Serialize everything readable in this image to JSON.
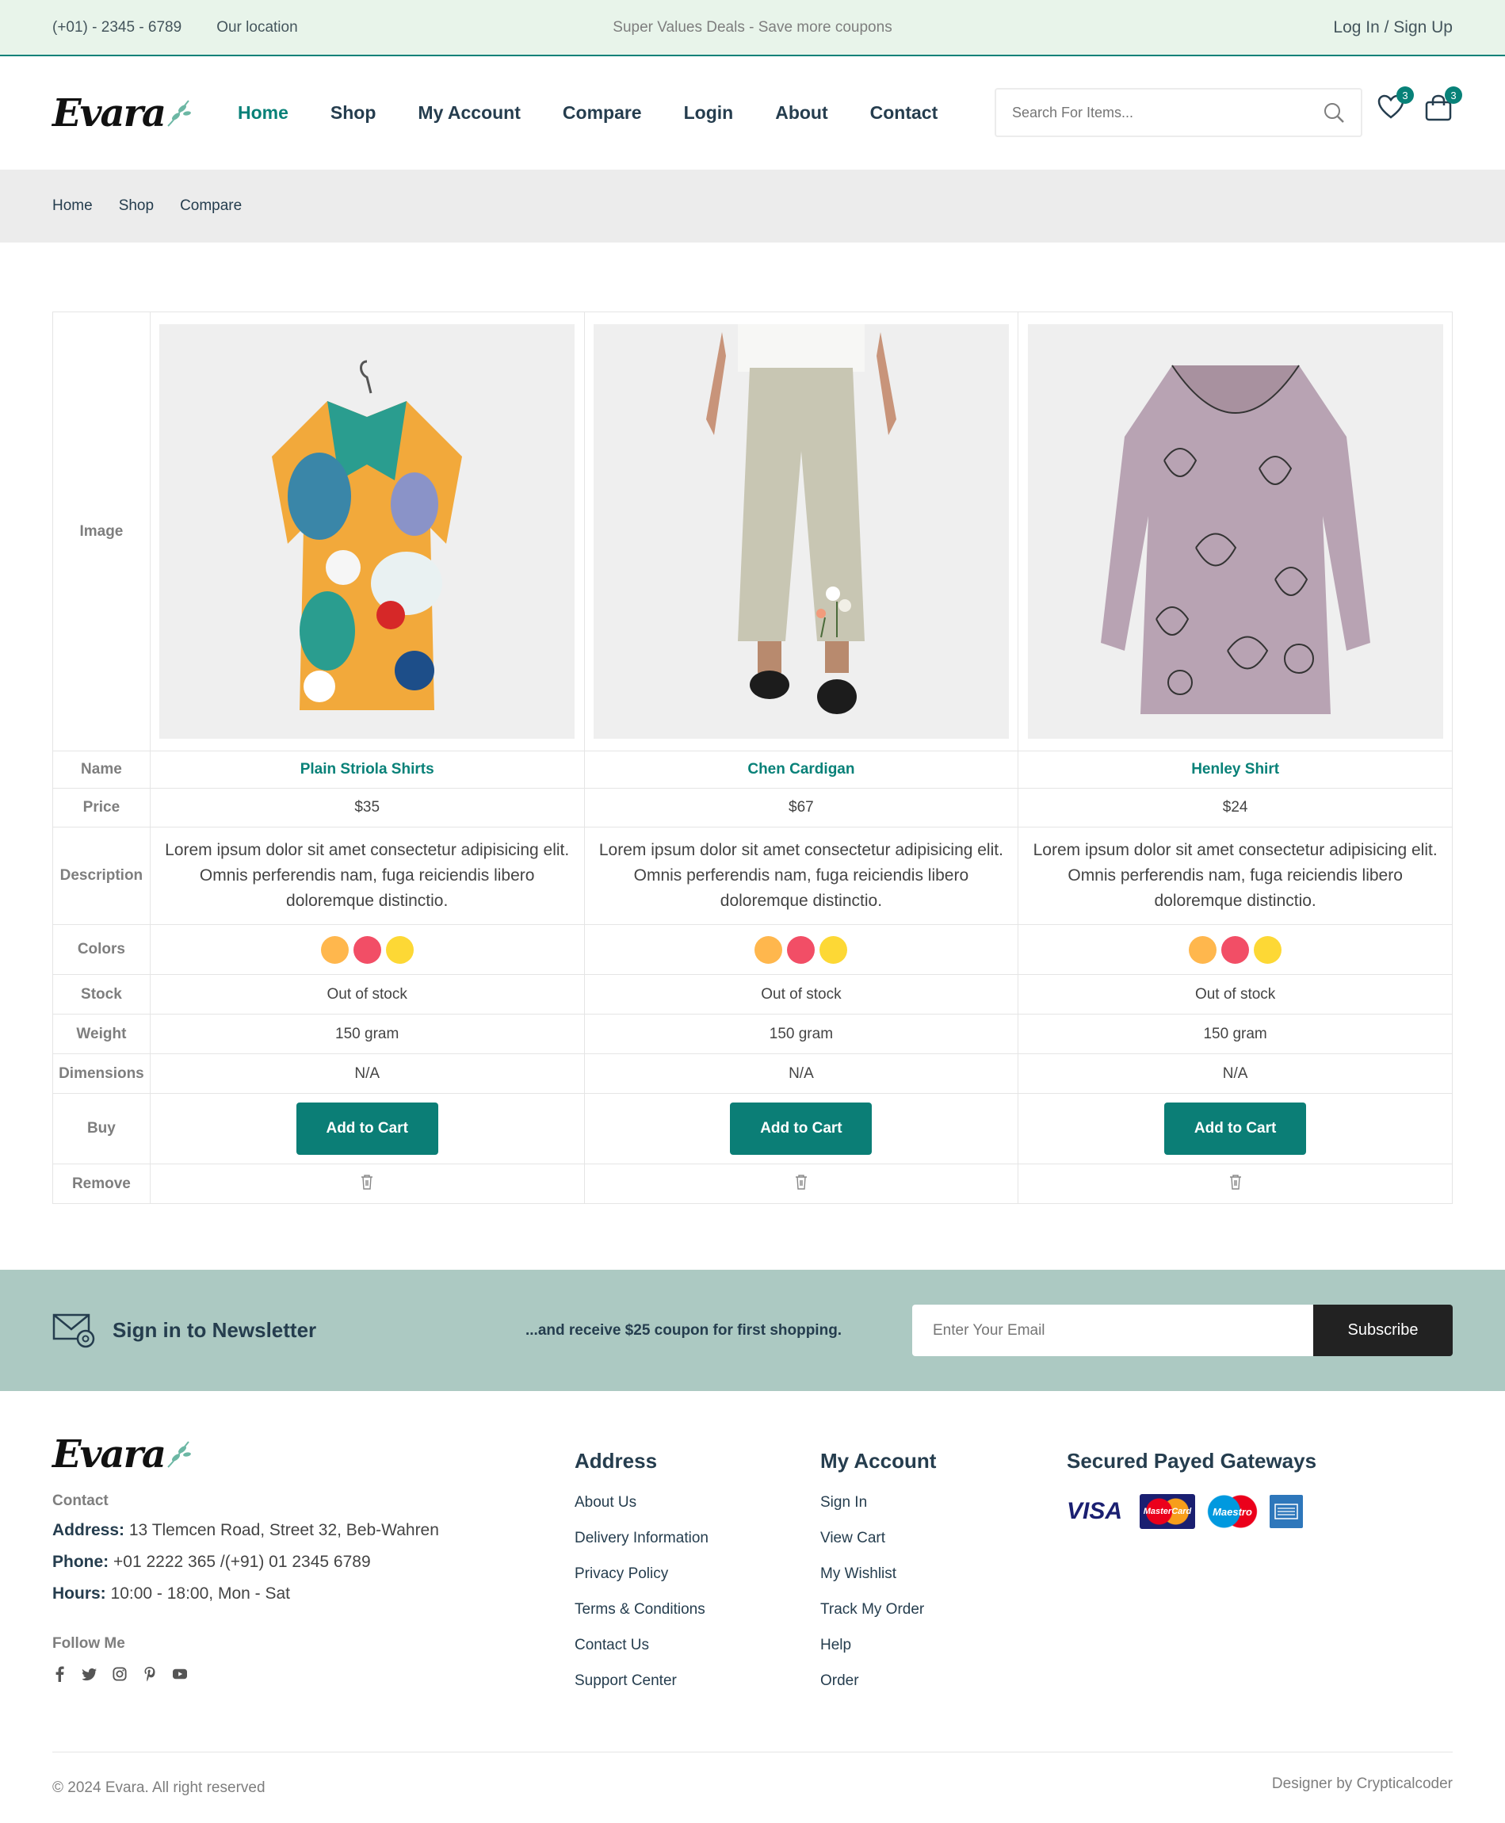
{
  "topbar": {
    "phone": "(+01) - 2345 - 6789",
    "location": "Our location",
    "promo": "Super Values Deals - Save more coupons",
    "auth": "Log In / Sign Up"
  },
  "header": {
    "logo": "Evara",
    "nav": [
      "Home",
      "Shop",
      "My Account",
      "Compare",
      "Login",
      "About",
      "Contact"
    ],
    "active_nav": "Home",
    "search_placeholder": "Search For Items...",
    "wishlist_count": "3",
    "cart_count": "3"
  },
  "breadcrumb": [
    "Home",
    "Shop",
    "Compare"
  ],
  "compare": {
    "labels": {
      "image": "Image",
      "name": "Name",
      "price": "Price",
      "description": "Description",
      "colors": "Colors",
      "stock": "Stock",
      "weight": "Weight",
      "dimensions": "Dimensions",
      "buy": "Buy",
      "remove": "Remove"
    },
    "products": [
      {
        "name": "Plain Striola Shirts",
        "price": "$35",
        "description": "Lorem ipsum dolor sit amet consectetur adipisicing elit. Omnis perferendis nam, fuga reiciendis libero doloremque distinctio.",
        "colors": [
          "#ffb74d",
          "#f24e66",
          "#fdd835"
        ],
        "stock": "Out of stock",
        "weight": "150 gram",
        "dimensions": "N/A",
        "buy_label": "Add to Cart",
        "image": "floral-shirt-image"
      },
      {
        "name": "Chen Cardigan",
        "price": "$67",
        "description": "Lorem ipsum dolor sit amet consectetur adipisicing elit. Omnis perferendis nam, fuga reiciendis libero doloremque distinctio.",
        "colors": [
          "#ffb74d",
          "#f24e66",
          "#fdd835"
        ],
        "stock": "Out of stock",
        "weight": "150 gram",
        "dimensions": "N/A",
        "buy_label": "Add to Cart",
        "image": "linen-pants-image"
      },
      {
        "name": "Henley Shirt",
        "price": "$24",
        "description": "Lorem ipsum dolor sit amet consectetur adipisicing elit. Omnis perferendis nam, fuga reiciendis libero doloremque distinctio.",
        "colors": [
          "#ffb74d",
          "#f24e66",
          "#fdd835"
        ],
        "stock": "Out of stock",
        "weight": "150 gram",
        "dimensions": "N/A",
        "buy_label": "Add to Cart",
        "image": "cat-print-blouse-image"
      }
    ]
  },
  "newsletter": {
    "title": "Sign in to Newsletter",
    "subtitle": "...and receive $25 coupon for first shopping.",
    "placeholder": "Enter Your Email",
    "button": "Subscribe"
  },
  "footer": {
    "logo": "Evara",
    "contact_heading": "Contact",
    "address_label": "Address:",
    "address": "13 Tlemcen Road, Street 32, Beb-Wahren",
    "phone_label": "Phone:",
    "phone": "+01 2222 365 /(+91) 01 2345 6789",
    "hours_label": "Hours:",
    "hours": "10:00 - 18:00, Mon - Sat",
    "follow": "Follow Me",
    "col1": {
      "title": "Address",
      "links": [
        "About Us",
        "Delivery Information",
        "Privacy Policy",
        "Terms & Conditions",
        "Contact Us",
        "Support Center"
      ]
    },
    "col2": {
      "title": "My Account",
      "links": [
        "Sign In",
        "View Cart",
        "My Wishlist",
        "Track My Order",
        "Help",
        "Order"
      ]
    },
    "gateways_title": "Secured Payed Gateways",
    "payments": {
      "visa": "VISA",
      "mastercard": "MasterCard",
      "maestro": "Maestro"
    },
    "copyright": "© 2024 Evara. All right reserved",
    "designer": "Designer by Crypticalcoder"
  }
}
